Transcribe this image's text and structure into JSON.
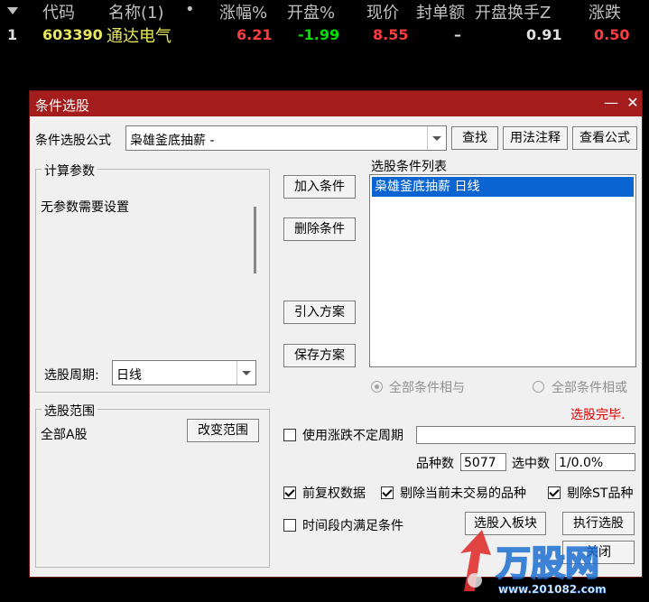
{
  "table": {
    "headers": [
      "代码",
      "名称(1)",
      "•",
      "涨幅%",
      "开盘%",
      "现价",
      "封单额",
      "开盘换手Z",
      "涨跌"
    ],
    "row": {
      "index": "1",
      "code": "603390",
      "name": "通达电气",
      "change_pct": "6.21",
      "open_pct": "-1.99",
      "price": "8.55",
      "seal_amount": "–",
      "open_turnover": "0.91",
      "change": "0.50"
    }
  },
  "dialog": {
    "title": "条件选股",
    "formula_label": "条件选股公式",
    "formula_value": "枭雄釜底抽薪 -",
    "btn_find": "查找",
    "btn_usage": "用法注释",
    "btn_view": "查看公式",
    "params_legend": "计算参数",
    "params_text": "无参数需要设置",
    "period_label": "选股周期:",
    "period_value": "日线",
    "btn_add": "加入条件",
    "btn_delete": "删除条件",
    "btn_import": "引入方案",
    "btn_save": "保存方案",
    "conditions_label": "选股条件列表",
    "conditions": [
      "枭雄釜底抽薪  日线"
    ],
    "radio_and": "全部条件相与",
    "radio_or": "全部条件相或",
    "status": "选股完毕.",
    "range_legend": "选股范围",
    "range_value": "全部A股",
    "btn_change_range": "改变范围",
    "chk_uncertain_period": "使用涨跌不定周期",
    "uncertain_period_value": "",
    "count_label": "品种数",
    "count_value": "5077",
    "selected_label": "选中数",
    "selected_value": "1/0.0%",
    "chk_adjust": "前复权数据",
    "chk_exclude_untraded": "剔除当前未交易的品种",
    "chk_exclude_st": "剔除ST品种",
    "chk_time_range": "时间段内满足条件",
    "btn_to_block": "选股入板块",
    "btn_execute": "执行选股",
    "btn_close": "关闭"
  },
  "watermark": {
    "brand": "万股网",
    "url": "www.201082.com"
  },
  "colors": {
    "titlebar": "#a51c1c",
    "selection": "#0a64d2",
    "up": "#ff3c3c",
    "down": "#00e000",
    "code": "#e8e85a",
    "status": "#e00000"
  }
}
